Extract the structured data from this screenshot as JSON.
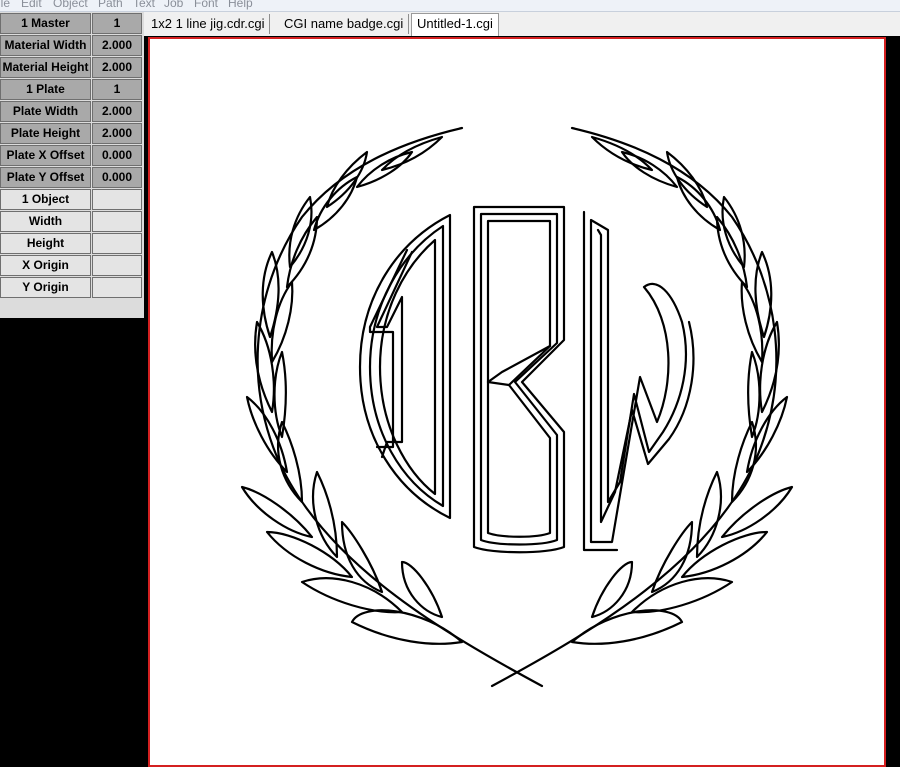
{
  "menu": [
    "ile",
    "Edit",
    "Object",
    "Path",
    "Text",
    "Job",
    "Font",
    "Help"
  ],
  "plate_props": [
    {
      "label": "1 Master",
      "value": "1"
    },
    {
      "label": "Material Width",
      "value": "2.000"
    },
    {
      "label": "Material Height",
      "value": "2.000"
    },
    {
      "label": "1 Plate",
      "value": "1"
    },
    {
      "label": "Plate Width",
      "value": "2.000"
    },
    {
      "label": "Plate Height",
      "value": "2.000"
    },
    {
      "label": "Plate X Offset",
      "value": "0.000"
    },
    {
      "label": "Plate Y Offset",
      "value": "0.000"
    }
  ],
  "object_props": [
    {
      "label": "1 Object",
      "value": ""
    },
    {
      "label": "Width",
      "value": ""
    },
    {
      "label": "Height",
      "value": ""
    },
    {
      "label": "X Origin",
      "value": ""
    },
    {
      "label": "Y Origin",
      "value": ""
    }
  ],
  "tabs": [
    {
      "label": "1x2 1 line jig.cdr.cgi",
      "active": false
    },
    {
      "label": "CGI name badge.cgi",
      "active": false
    },
    {
      "label": "Untitled-1.cgi",
      "active": true
    }
  ],
  "colors": {
    "canvas_border": "#d42020",
    "plate_cell": "#a9a9a9",
    "object_cell": "#e4e4e4",
    "workspace": "#000000"
  },
  "design": {
    "type": "monogram with laurel wreath",
    "monogram": [
      "D",
      "B",
      "W"
    ]
  }
}
